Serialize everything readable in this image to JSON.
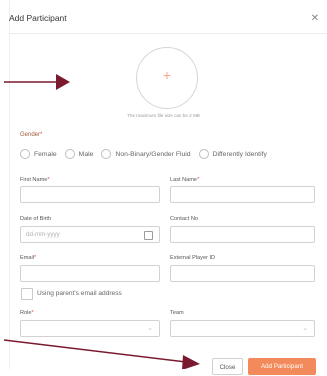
{
  "modal": {
    "title": "Add Participant",
    "close_icon": "close-icon"
  },
  "upload": {
    "plus_glyph": "+",
    "hint": "The maximum file size can be 2 MB"
  },
  "gender": {
    "label": "Gender",
    "required_mark": "*",
    "options": [
      "Female",
      "Male",
      "Non-Binary/Gender Fluid",
      "Differently Identify"
    ]
  },
  "fields": {
    "first_name": {
      "label": "First Name",
      "required_mark": "*"
    },
    "last_name": {
      "label": "Last Name",
      "required_mark": "*"
    },
    "dob": {
      "label": "Date of Birth",
      "placeholder": "dd-mm-yyyy"
    },
    "contact": {
      "label": "Contact No"
    },
    "email": {
      "label": "Email",
      "required_mark": "*"
    },
    "external_id": {
      "label": "External Player ID"
    },
    "parent_email": {
      "label": "Using parent's email address"
    },
    "role": {
      "label": "Role",
      "required_mark": "*"
    },
    "team": {
      "label": "Team"
    }
  },
  "buttons": {
    "close": "Close",
    "add": "Add Participant"
  },
  "colors": {
    "accent": "#f28a5b",
    "required": "#e0533b",
    "arrow": "#7a1a2e"
  }
}
